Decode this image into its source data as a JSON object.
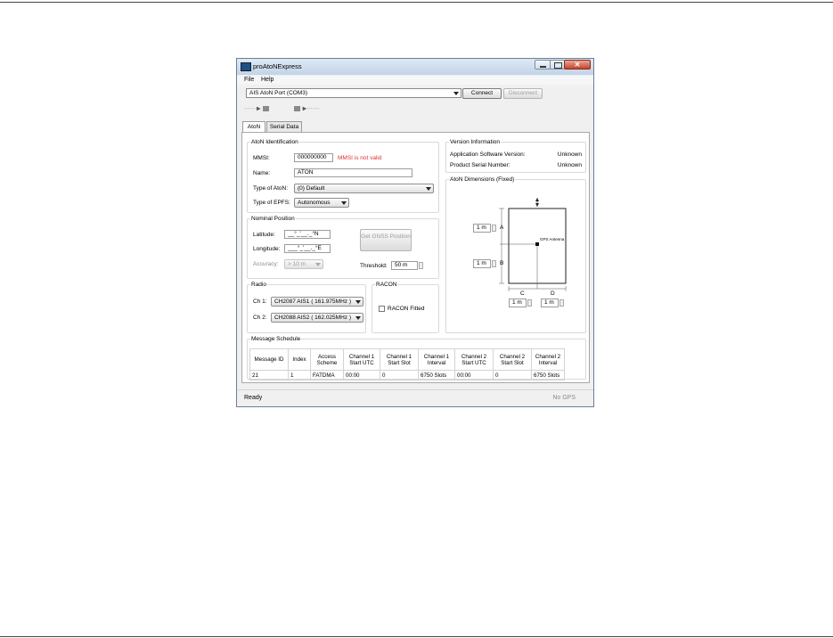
{
  "window": {
    "title": "proAtoNExpress"
  },
  "menu": {
    "file": "File",
    "help": "Help"
  },
  "port": {
    "selected": "AIS AtoN Port (COM3)",
    "connect": "Connect",
    "disconnect": "Disconnect"
  },
  "toolbar": {
    "read_label": "·······▶",
    "write_label": "▶·······"
  },
  "tabs": [
    "AtoN",
    "Serial Data"
  ],
  "aton_identification": {
    "title": "AtoN Identification",
    "mmsi_label": "MMSI:",
    "mmsi_value": "000000000",
    "mmsi_error": "MMSI is not valid",
    "name_label": "Name:",
    "name_value": "ATON",
    "type_label": "Type of AtoN:",
    "type_value": "(0) Default",
    "epfs_label": "Type of EPFS:",
    "epfs_value": "Autonomous"
  },
  "nominal_position": {
    "title": "Nominal Position",
    "lat_label": "Latitude:",
    "lat_value": "__°_'__._°N",
    "lon_label": "Longitude:",
    "lon_value": "___°_'__._°E",
    "acc_label": "Accuracy:",
    "acc_value": "> 10 m",
    "gnss_button": "Get GNSS Position",
    "threshold_label": "Threshold:",
    "threshold_value": "50 m"
  },
  "radio": {
    "title": "Radio",
    "ch1_label": "Ch 1:",
    "ch1_value": "CH2087 AIS1 ( 161.975MHz )",
    "ch2_label": "Ch 2:",
    "ch2_value": "CH2088 AIS2 ( 162.025MHz )"
  },
  "racon": {
    "title": "RACON",
    "fitted_label": "RACON Fitted"
  },
  "version": {
    "title": "Version Information",
    "app_label": "Application Software Version:",
    "app_value": "Unknown",
    "serial_label": "Product Serial Number:",
    "serial_value": "Unknown"
  },
  "dimensions": {
    "title": "AtoN Dimensions (Fixed)",
    "a_label": "A",
    "a_value": "1 m",
    "b_label": "B",
    "b_value": "1 m",
    "c_label": "C",
    "c_value": "1 m",
    "d_label": "D",
    "d_value": "1 m",
    "antenna_label": "GPS Antenna"
  },
  "schedule": {
    "title": "Message Schedule",
    "headers": [
      "Message ID",
      "Index",
      "Access Scheme",
      "Channel 1 Start UTC",
      "Channel 1 Start Slot",
      "Channel 1 Interval",
      "Channel 2 Start UTC",
      "Channel 2 Start Slot",
      "Channel 2 Interval"
    ],
    "rows": [
      [
        "21",
        "1",
        "FATDMA",
        "00:00",
        "0",
        "6750 Slots",
        "00:00",
        "0",
        "6750 Slots"
      ]
    ]
  },
  "status": {
    "left": "Ready",
    "right": "No GPS"
  }
}
